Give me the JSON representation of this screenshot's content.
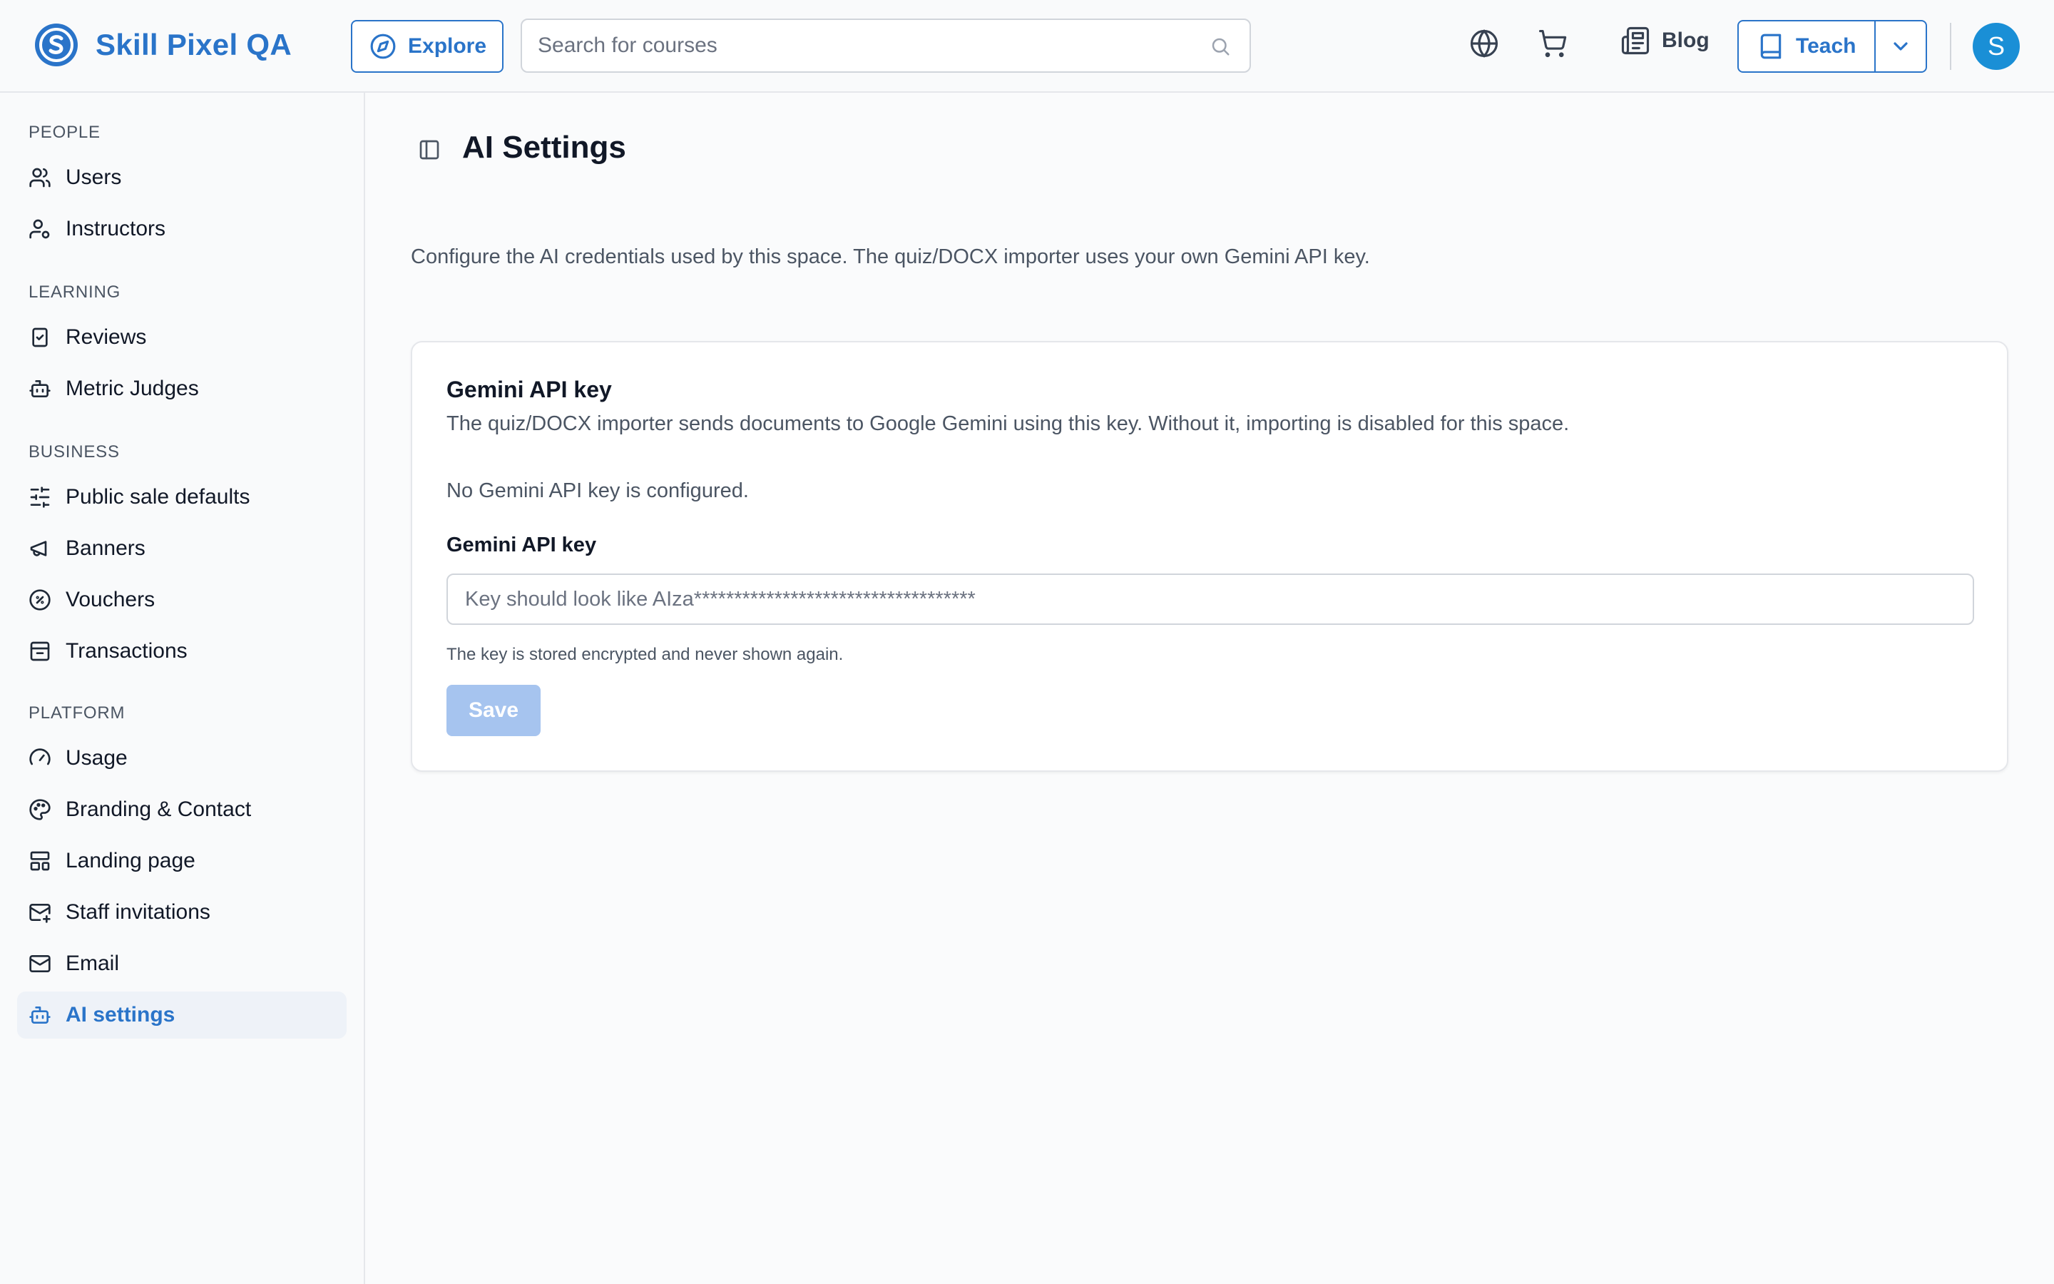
{
  "brand": {
    "name": "Skill Pixel QA",
    "accent": "#2a74c9"
  },
  "header": {
    "explore_label": "Explore",
    "search_placeholder": "Search for courses",
    "search_value": "",
    "blog_label": "Blog",
    "teach_label": "Teach",
    "avatar_initial": "S",
    "icons": [
      "compass-icon",
      "search-icon",
      "globe-icon",
      "cart-icon",
      "newspaper-icon",
      "book-icon",
      "chevron-down-icon"
    ]
  },
  "sidebar": {
    "sections": [
      {
        "title": "PEOPLE",
        "items": [
          {
            "label": "Users",
            "icon": "users-icon"
          },
          {
            "label": "Instructors",
            "icon": "user-cog-icon"
          }
        ]
      },
      {
        "title": "LEARNING",
        "items": [
          {
            "label": "Reviews",
            "icon": "clipboard-check-icon"
          },
          {
            "label": "Metric Judges",
            "icon": "bot-icon"
          }
        ]
      },
      {
        "title": "BUSINESS",
        "items": [
          {
            "label": "Public sale defaults",
            "icon": "sliders-icon"
          },
          {
            "label": "Banners",
            "icon": "megaphone-icon"
          },
          {
            "label": "Vouchers",
            "icon": "badge-percent-icon"
          },
          {
            "label": "Transactions",
            "icon": "archive-icon"
          }
        ]
      },
      {
        "title": "PLATFORM",
        "items": [
          {
            "label": "Usage",
            "icon": "gauge-icon"
          },
          {
            "label": "Branding & Contact",
            "icon": "palette-icon"
          },
          {
            "label": "Landing page",
            "icon": "layout-icon"
          },
          {
            "label": "Staff invitations",
            "icon": "mail-plus-icon"
          },
          {
            "label": "Email",
            "icon": "mail-icon"
          },
          {
            "label": "AI settings",
            "icon": "bot-icon",
            "active": true
          }
        ]
      }
    ]
  },
  "main": {
    "title": "AI Settings",
    "intro": "Configure the AI credentials used by this space. The quiz/DOCX importer uses your own Gemini API key.",
    "card": {
      "title": "Gemini API key",
      "description": "The quiz/DOCX importer sends documents to Google Gemini using this key. Without it, importing is disabled for this space.",
      "status": "No Gemini API key is configured.",
      "field_label": "Gemini API key",
      "input_placeholder": "Key should look like AIza***********************************",
      "input_value": "",
      "hint": "The key is stored encrypted and never shown again.",
      "save_label": "Save"
    }
  }
}
